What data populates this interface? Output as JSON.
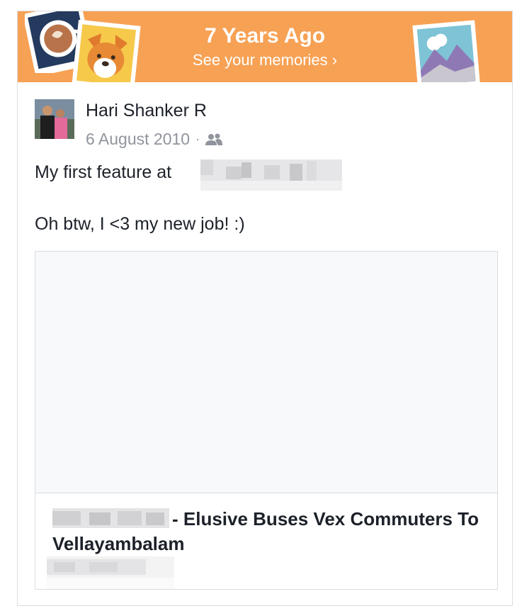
{
  "banner": {
    "title": "7 Years Ago",
    "subtitle": "See your memories ›",
    "background_color": "#f7a154",
    "icons": [
      "coffee-cup-photo-icon",
      "dog-photo-icon",
      "mountain-photo-icon"
    ]
  },
  "post": {
    "author": "Hari Shanker R",
    "date": "6 August 2010",
    "separator": "·",
    "privacy_icon": "friends-icon",
    "text_line1": "My first feature at",
    "text_line2": "Oh btw, I <3 my new job! :)"
  },
  "link_preview": {
    "title_suffix": "- Elusive Buses Vex Commuters To Vellayambalam"
  }
}
